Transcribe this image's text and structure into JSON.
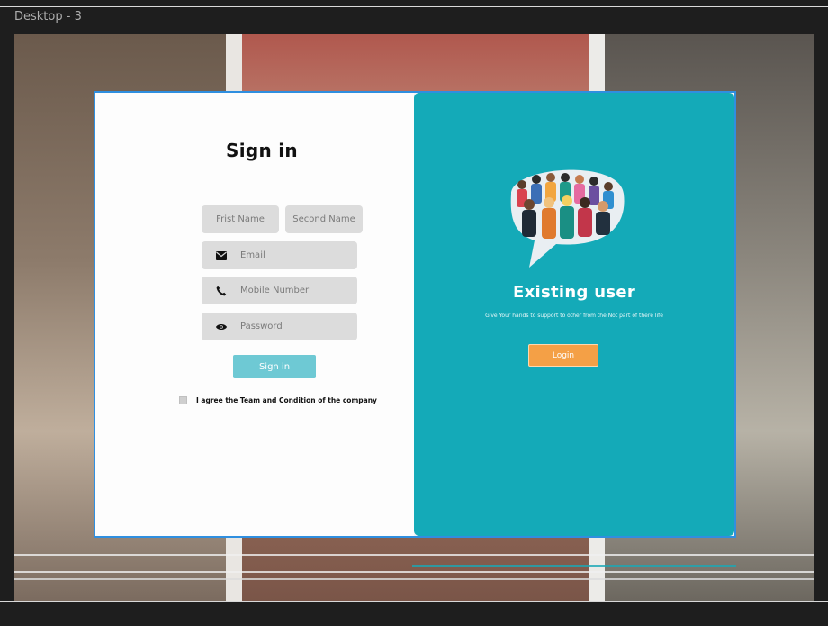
{
  "frame": {
    "label": "Desktop - 3"
  },
  "signin": {
    "title": "Sign in",
    "first_name_placeholder": "Frist Name",
    "second_name_placeholder": "Second Name",
    "email_placeholder": "Email",
    "mobile_placeholder": "Mobile Number",
    "password_placeholder": "Password",
    "button_label": "Sign in",
    "agree_text": "I agree the Team and  Condition of the company"
  },
  "existing": {
    "title": "Existing user",
    "subtitle": "Give Your hands to support to other from the Not part of there life",
    "button_label": "Login"
  },
  "colors": {
    "teal_panel": "#14aab8",
    "signin_button": "#6ec9d4",
    "login_button": "#f4a046",
    "card_border": "#2f8fe0"
  },
  "icons": [
    "mail-icon",
    "phone-icon",
    "eye-icon",
    "crowd-speech-bubble-illustration"
  ]
}
